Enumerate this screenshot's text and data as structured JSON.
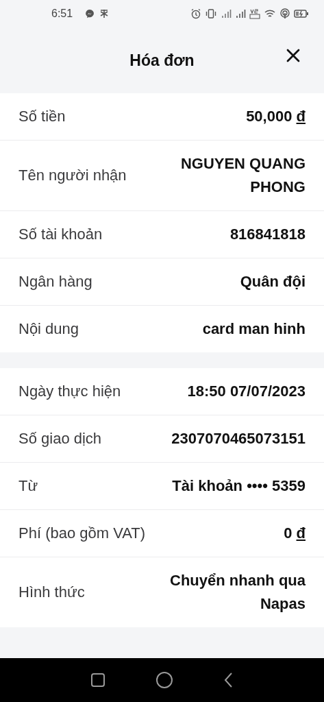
{
  "status_bar": {
    "time": "6:51"
  },
  "header": {
    "title": "Hóa đơn"
  },
  "sections": [
    {
      "rows": [
        {
          "label": "Số tiền",
          "value": "50,000",
          "unit": "đ"
        },
        {
          "label": "Tên người nhận",
          "value": "NGUYEN QUANG PHONG"
        },
        {
          "label": "Số tài khoản",
          "value": "816841818"
        },
        {
          "label": "Ngân hàng",
          "value": "Quân đội"
        },
        {
          "label": "Nội dung",
          "value": "card man hinh"
        }
      ]
    },
    {
      "rows": [
        {
          "label": "Ngày thực hiện",
          "value": "18:50 07/07/2023"
        },
        {
          "label": "Số giao dịch",
          "value": "2307070465073151"
        },
        {
          "label": "Từ",
          "value": "Tài khoản •••• 5359"
        },
        {
          "label": "Phí (bao gồm VAT)",
          "value": "0",
          "unit": "đ"
        },
        {
          "label": "Hình thức",
          "value": "Chuyển nhanh qua Napas"
        }
      ]
    }
  ]
}
